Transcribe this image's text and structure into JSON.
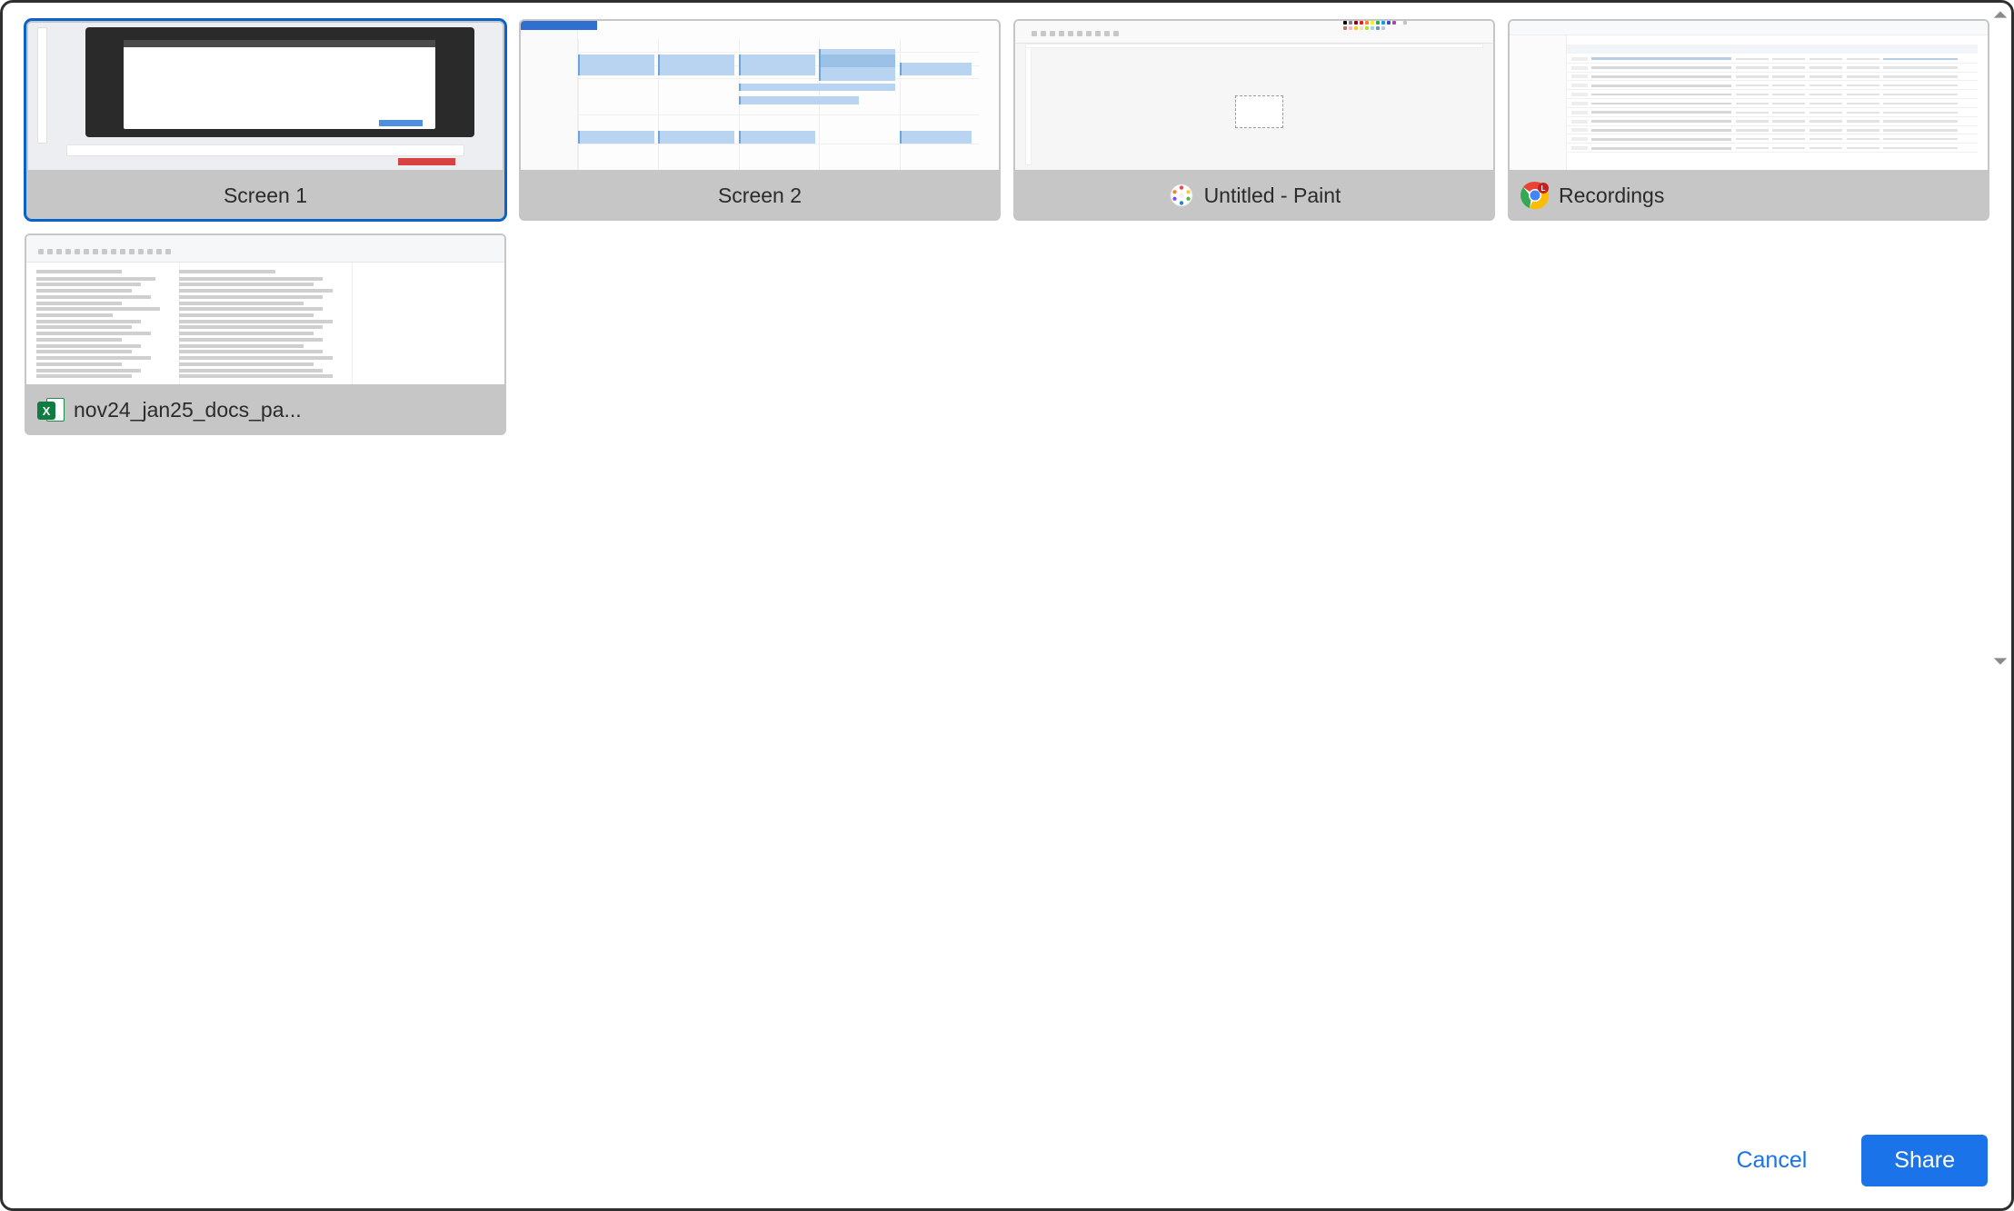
{
  "dialog": {
    "cancel_label": "Cancel",
    "share_label": "Share"
  },
  "tiles": [
    {
      "label": "Screen 1",
      "icon": null,
      "selected": true
    },
    {
      "label": "Screen 2",
      "icon": null,
      "selected": false
    },
    {
      "label": "Untitled - Paint",
      "icon": "paint",
      "selected": false
    },
    {
      "label": "Recordings",
      "icon": "chrome",
      "selected": false
    },
    {
      "label": "nov24_jan25_docs_pa...",
      "icon": "excel",
      "selected": false
    }
  ]
}
